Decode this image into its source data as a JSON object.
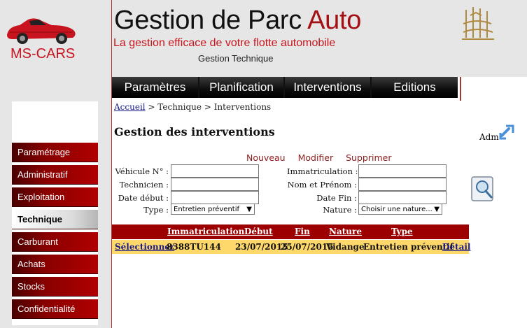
{
  "brand": {
    "name": "MS-CARS"
  },
  "header": {
    "title_main": "Gestion de Parc ",
    "title_accent": "Auto",
    "subtitle": "La gestion efficace de votre flotte automobile",
    "section": "Gestion Technique"
  },
  "topnav": {
    "items": [
      "Paramètres",
      "Planification",
      "Interventions",
      "Editions"
    ]
  },
  "sidebar": {
    "items": [
      {
        "label": "Paramétrage"
      },
      {
        "label": "Administratif"
      },
      {
        "label": "Exploitation"
      },
      {
        "label": "Technique"
      },
      {
        "label": "Carburant"
      },
      {
        "label": "Achats"
      },
      {
        "label": "Stocks"
      },
      {
        "label": "Confidentialité"
      }
    ]
  },
  "breadcrumb": {
    "home": "Accueil",
    "rest": " > Technique > Interventions"
  },
  "page": {
    "title": "Gestion des interventions",
    "user": "Adm"
  },
  "actions": {
    "new": "Nouveau",
    "edit": "Modifier",
    "delete": "Supprimer"
  },
  "form": {
    "vehicule_label": "Véhicule N° :",
    "technicien_label": "Technicien :",
    "date_debut_label": "Date début :",
    "type_label": "Type :",
    "type_value": "Entretien préventif",
    "immat_label": "Immatriculation :",
    "nom_label": "Nom et Prénom :",
    "date_fin_label": "Date Fin :",
    "nature_label": "Nature :",
    "nature_value": "Choisir une nature..."
  },
  "table": {
    "headers": [
      "Immatriculation",
      "Début",
      "Fin",
      "Nature",
      "Type"
    ],
    "rows": [
      {
        "select": "Sélectionner",
        "immat": "8388TU144",
        "debut": "23/07/2015",
        "fin": "25/07/2015",
        "nature": "Vidange",
        "type": "Entretien préventif",
        "detail": "Détail"
      }
    ]
  },
  "colors": {
    "accent": "#a40f14",
    "nav": "#000000",
    "row_highlight": "#ffd86b",
    "table_header": "#9c0000"
  }
}
